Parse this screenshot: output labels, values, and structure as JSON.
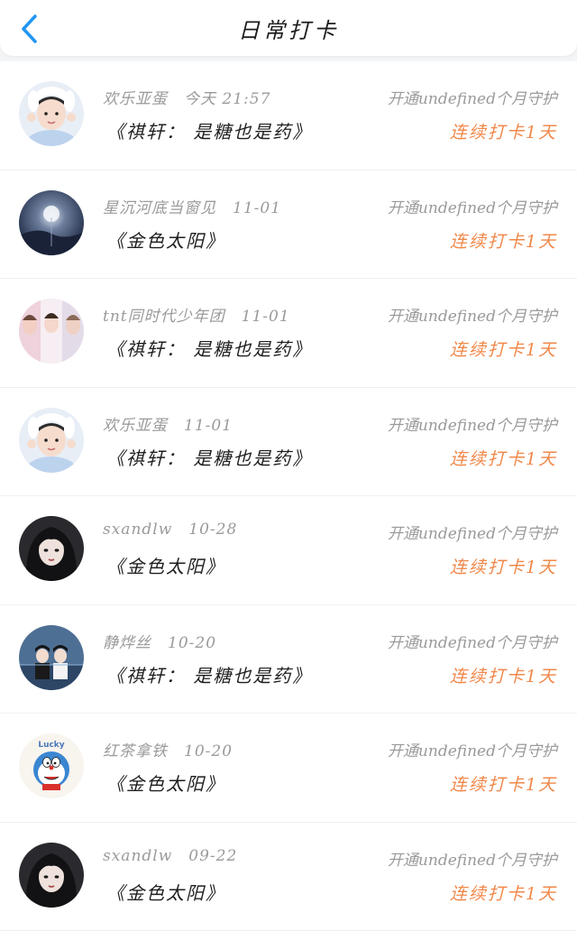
{
  "header": {
    "title": "日常打卡",
    "back_icon": "chevron-left-icon",
    "accent_color": "#2196f3"
  },
  "colors": {
    "streak": "#f0884a",
    "muted": "#9a9a9a"
  },
  "entries": [
    {
      "name": "欢乐亚蛋",
      "time": "今天 21:57",
      "guard": "开通undefined个月守护",
      "song": "《祺轩： 是糖也是药》",
      "streak": "连续打卡1天",
      "avatar": "avatar-girl-bunny-hat"
    },
    {
      "name": "星沉河底当窗见",
      "time": "11-01",
      "guard": "开通undefined个月守护",
      "song": "《金色太阳》",
      "streak": "连续打卡1天",
      "avatar": "avatar-night-moon"
    },
    {
      "name": "tnt同时代少年团",
      "time": "11-01",
      "guard": "开通undefined个月守护",
      "song": "《祺轩： 是糖也是药》",
      "streak": "连续打卡1天",
      "avatar": "avatar-group-photo"
    },
    {
      "name": "欢乐亚蛋",
      "time": "11-01",
      "guard": "开通undefined个月守护",
      "song": "《祺轩： 是糖也是药》",
      "streak": "连续打卡1天",
      "avatar": "avatar-girl-bunny-hat"
    },
    {
      "name": "sxandlw",
      "time": "10-28",
      "guard": "开通undefined个月守护",
      "song": "《金色太阳》",
      "streak": "连续打卡1天",
      "avatar": "avatar-dark-hair-girl"
    },
    {
      "name": "静烨丝",
      "time": "10-20",
      "guard": "开通undefined个月守护",
      "song": "《祺轩： 是糖也是药》",
      "streak": "连续打卡1天",
      "avatar": "avatar-anime-couple"
    },
    {
      "name": "红茶拿铁",
      "time": "10-20",
      "guard": "开通undefined个月守护",
      "song": "《金色太阳》",
      "streak": "连续打卡1天",
      "avatar": "avatar-doraemon-lucky"
    },
    {
      "name": "sxandlw",
      "time": "09-22",
      "guard": "开通undefined个月守护",
      "song": "《金色太阳》",
      "streak": "连续打卡1天",
      "avatar": "avatar-dark-hair-girl"
    }
  ],
  "avatar_badge_text": "Lucky"
}
